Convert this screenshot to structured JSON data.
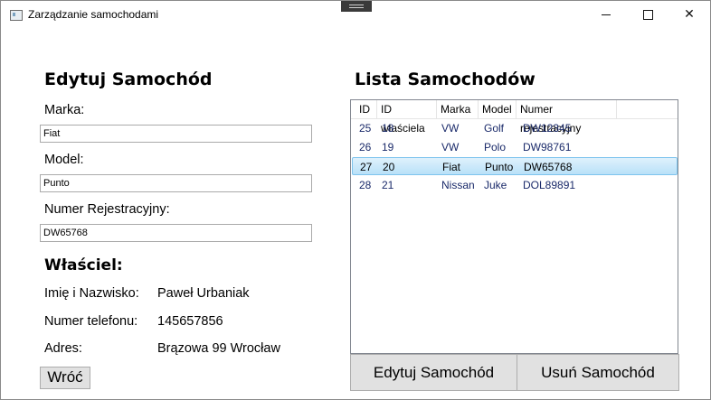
{
  "window": {
    "title": "Zarządzanie samochodami"
  },
  "edit": {
    "heading": "Edytuj Samochód",
    "marka_label": "Marka:",
    "marka_value": "Fiat",
    "model_label": "Model:",
    "model_value": "Punto",
    "nr_label": "Numer Rejestracyjny:",
    "nr_value": "DW65768"
  },
  "owner": {
    "heading": "Właściel:",
    "name_label": "Imię i Nazwisko:",
    "name_value": "Paweł Urbaniak",
    "phone_label": "Numer telefonu:",
    "phone_value": "145657856",
    "address_label": "Adres:",
    "address_value": "Brązowa 99 Wrocław"
  },
  "back_label": "Wróć",
  "list": {
    "heading": "Lista Samochodów",
    "columns": [
      "ID",
      "ID właściela",
      "Marka",
      "Model",
      "Numer rejestracyjny"
    ],
    "rows": [
      [
        "25",
        "18",
        "VW",
        "Golf",
        "DW12345"
      ],
      [
        "26",
        "19",
        "VW",
        "Polo",
        "DW98761"
      ],
      [
        "27",
        "20",
        "Fiat",
        "Punto",
        "DW65768"
      ],
      [
        "28",
        "21",
        "Nissan",
        "Juke",
        "DOL89891"
      ]
    ],
    "selected_row": 2
  },
  "actions": {
    "edit_label": "Edytuj Samochód",
    "delete_label": "Usuń Samochód"
  }
}
